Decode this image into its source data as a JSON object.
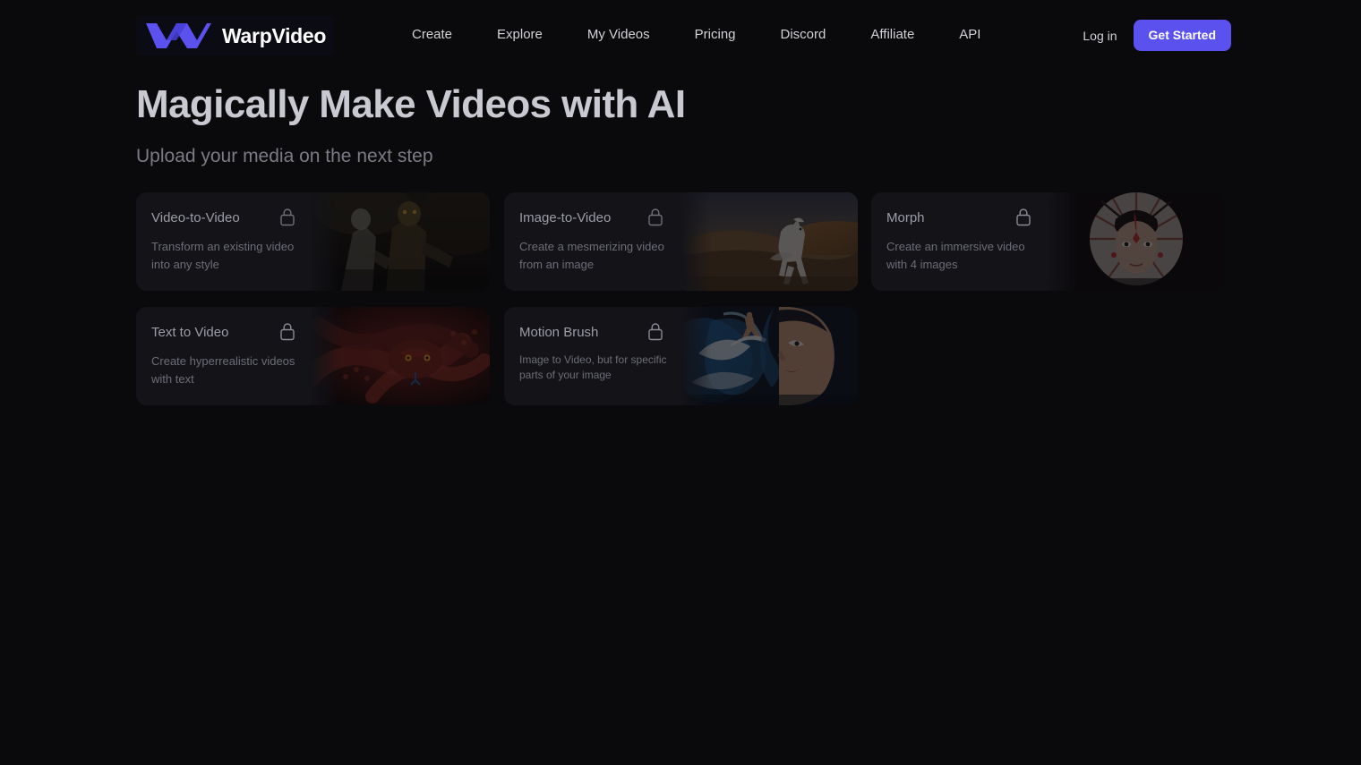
{
  "brand": {
    "name": "WarpVideo",
    "logo_icon": "warp-w-logo-icon",
    "logo_color": "#5b51ef"
  },
  "header": {
    "nav": [
      {
        "label": "Create"
      },
      {
        "label": "Explore"
      },
      {
        "label": "My Videos"
      },
      {
        "label": "Pricing"
      },
      {
        "label": "Discord"
      },
      {
        "label": "Affiliate"
      },
      {
        "label": "API"
      }
    ],
    "login_label": "Log in",
    "cta_label": "Get Started",
    "cta_color": "#5b51ef"
  },
  "hero": {
    "title": "Magically Make Videos with AI",
    "subtitle": "Upload your media on the next step"
  },
  "cards": [
    {
      "id": "video-to-video",
      "title": "Video-to-Video",
      "description": "Transform an existing video into any style",
      "locked": true,
      "lock_icon": "lock-icon",
      "thumbnail": "warrior-fighters-dark-scene"
    },
    {
      "id": "image-to-video",
      "title": "Image-to-Video",
      "description": "Create a mesmerizing video from an image",
      "locked": true,
      "lock_icon": "lock-icon",
      "thumbnail": "white-horse-running-desert-dunes"
    },
    {
      "id": "morph",
      "title": "Morph",
      "description": "Create an immersive video with 4 images",
      "locked": true,
      "lock_icon": "lock-icon",
      "thumbnail": "woman-portrait-with-white-red-fan"
    },
    {
      "id": "text-to-video",
      "title": "Text to Video",
      "description": "Create hyperrealistic videos with text",
      "locked": true,
      "lock_icon": "lock-icon",
      "thumbnail": "coiled-red-snake"
    },
    {
      "id": "motion-brush",
      "title": "Motion Brush",
      "description": "Image to Video, but for specific parts of your image",
      "locked": true,
      "lock_icon": "lock-icon",
      "thumbnail": "surfer-on-blue-wave-hair-woman-profile"
    }
  ],
  "colors": {
    "page_background": "#0a0a0d",
    "card_background": "#131318",
    "heading_text": "#c9c9d1",
    "muted_text": "#6d6d77"
  }
}
